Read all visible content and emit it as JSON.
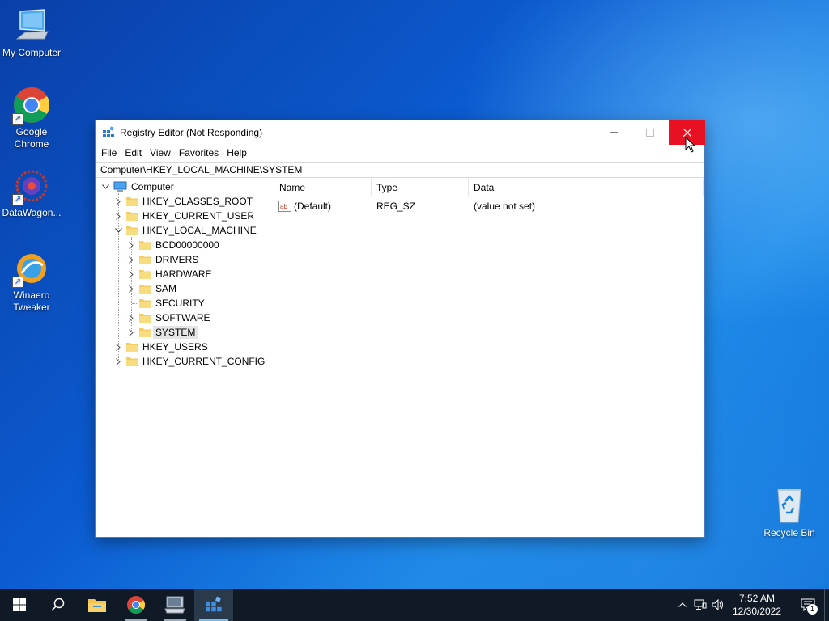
{
  "desktop": {
    "icons": [
      {
        "label": "My Computer",
        "icon": "computer-icon"
      },
      {
        "label": "Google Chrome",
        "icon": "chrome-icon"
      },
      {
        "label": "DataWagon...",
        "icon": "datawagon-icon"
      },
      {
        "label": "Winaero Tweaker",
        "icon": "winaero-icon"
      }
    ],
    "recycle_bin": {
      "label": "Recycle Bin",
      "icon": "recycle-bin-icon"
    },
    "shortcut_arrow": "↗"
  },
  "window": {
    "title": "Registry Editor (Not Responding)",
    "menu": [
      "File",
      "Edit",
      "View",
      "Favorites",
      "Help"
    ],
    "address": "Computer\\HKEY_LOCAL_MACHINE\\SYSTEM",
    "tree": {
      "root": "Computer",
      "hives": [
        {
          "label": "HKEY_CLASSES_ROOT"
        },
        {
          "label": "HKEY_CURRENT_USER"
        },
        {
          "label": "HKEY_LOCAL_MACHINE"
        },
        {
          "label": "HKEY_USERS"
        },
        {
          "label": "HKEY_CURRENT_CONFIG"
        }
      ],
      "local_machine_children": [
        {
          "label": "BCD00000000"
        },
        {
          "label": "DRIVERS"
        },
        {
          "label": "HARDWARE"
        },
        {
          "label": "SAM"
        },
        {
          "label": "SECURITY"
        },
        {
          "label": "SOFTWARE"
        },
        {
          "label": "SYSTEM"
        }
      ]
    },
    "list": {
      "columns": [
        "Name",
        "Type",
        "Data"
      ],
      "rows": [
        {
          "name": "(Default)",
          "type": "REG_SZ",
          "data": "(value not set)"
        }
      ]
    }
  },
  "taskbar": {
    "apps": [
      "start-icon",
      "search-icon",
      "file-explorer-icon",
      "chrome-icon",
      "my-computer-icon",
      "registry-editor-icon"
    ],
    "time": "7:52 AM",
    "date": "12/30/2022",
    "notification_count": "1"
  },
  "colors": {
    "close_button": "#e81123",
    "taskbar": "#101a26",
    "folder": "#f3cd63"
  }
}
